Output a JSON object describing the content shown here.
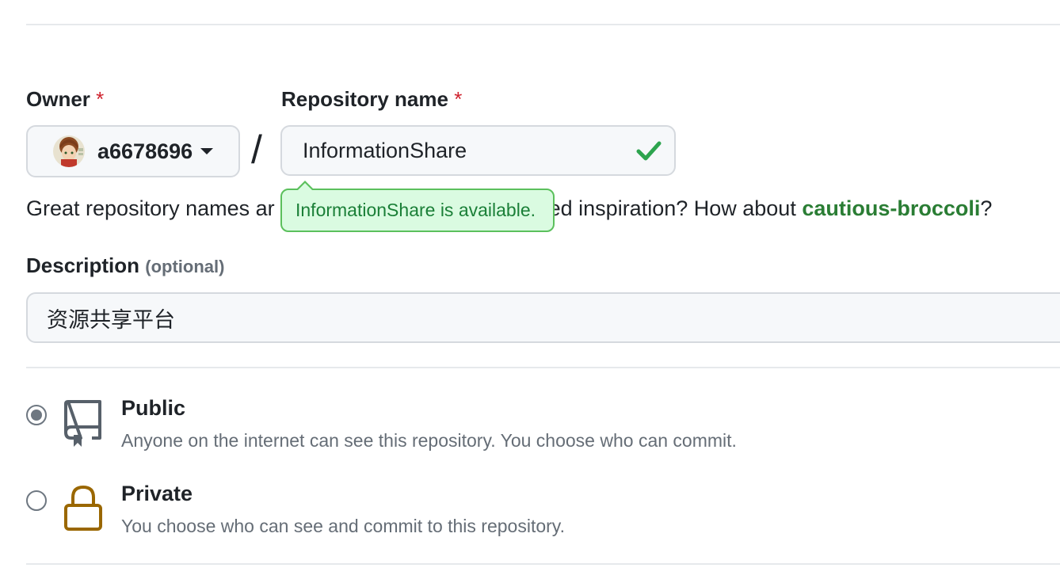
{
  "owner": {
    "label": "Owner",
    "required_mark": "*",
    "value": "a6678696"
  },
  "repo": {
    "label": "Repository name",
    "required_mark": "*",
    "value": "InformationShare"
  },
  "separator": "/",
  "help": {
    "text_before": "Great repository names ar",
    "text_after": "ed inspiration? How about ",
    "suggestion": "cautious-broccoli",
    "text_end": "?"
  },
  "tooltip": {
    "text": "InformationShare is available."
  },
  "description": {
    "label": "Description",
    "optional": "(optional)",
    "value": "资源共享平台"
  },
  "visibility": {
    "public": {
      "title": "Public",
      "desc": "Anyone on the internet can see this repository. You choose who can commit.",
      "selected": true
    },
    "private": {
      "title": "Private",
      "desc": "You choose who can see and commit to this repository.",
      "selected": false
    }
  },
  "colors": {
    "success": "#2da44e",
    "link": "#2a7d34",
    "lock": "#9a6700",
    "icon": "#57606a"
  },
  "icons": [
    "avatar",
    "chevron-down-icon",
    "check-icon",
    "repo-icon",
    "lock-icon"
  ]
}
